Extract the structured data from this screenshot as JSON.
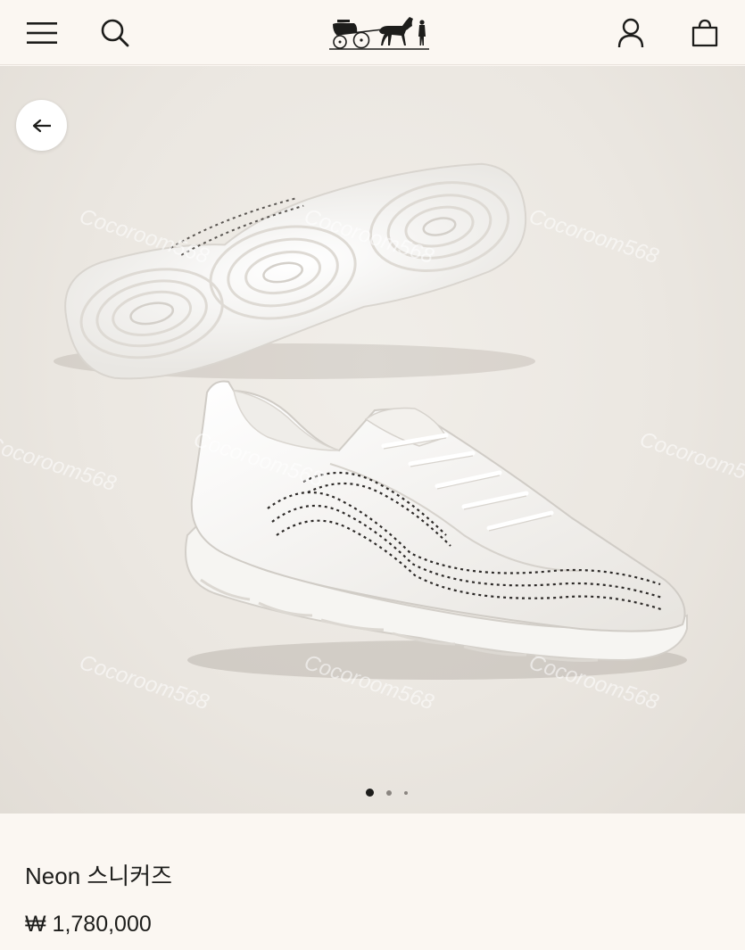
{
  "header": {
    "icons": {
      "menu": "hamburger-menu-icon",
      "search": "search-icon",
      "logo": "carriage-logo",
      "account": "person-icon",
      "bag": "shopping-bag-icon"
    }
  },
  "gallery": {
    "back_icon": "arrow-left-icon",
    "watermark": "Cocoroom568",
    "slide_count": 3,
    "active_slide": 1
  },
  "product": {
    "name": "Neon 스니커즈",
    "price": "₩ 1,780,000"
  },
  "colors": {
    "background": "#fbf7f2",
    "photo_background": "#ebe7e1",
    "text": "#1d1d1b"
  }
}
